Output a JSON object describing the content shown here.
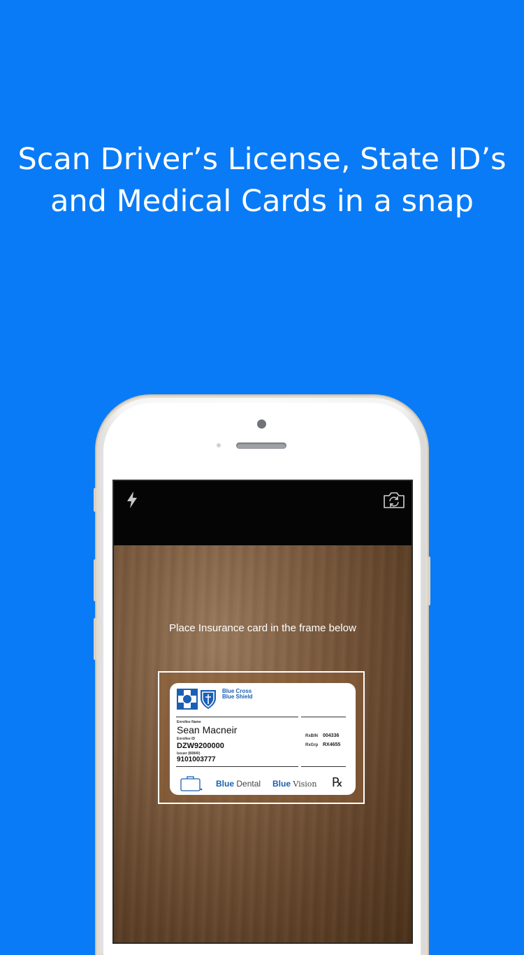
{
  "headline": {
    "line1": "Scan Driver’s License, State ID’s",
    "line2": "and Medical Cards in a snap"
  },
  "camera": {
    "flash_icon": "flash-icon",
    "switch_icon": "switch-camera-icon",
    "instruction": "Place Insurance card in the frame below"
  },
  "card": {
    "brand_line1": "Blue Cross",
    "brand_line2": "Blue Shield",
    "enrollee_name_label": "Enrollee Name",
    "enrollee_name": "Sean Macneir",
    "enrollee_id_label": "Enrollee ID",
    "enrollee_id": "DZW9200000",
    "issuer_label": "Issuer (80840)",
    "issuer_number": "9101003777",
    "rxbin_label": "RxBIN",
    "rxbin_value": "004336",
    "rxgrp_label": "RxGrp",
    "rxgrp_value": "RX4655",
    "dental_blue": "Blue",
    "dental_word": "Dental",
    "vision_blue": "Blue",
    "vision_word": "Vision",
    "rx_symbol": "℞"
  },
  "colors": {
    "background": "#0a7bf6",
    "brand_blue": "#1a5fb4"
  }
}
